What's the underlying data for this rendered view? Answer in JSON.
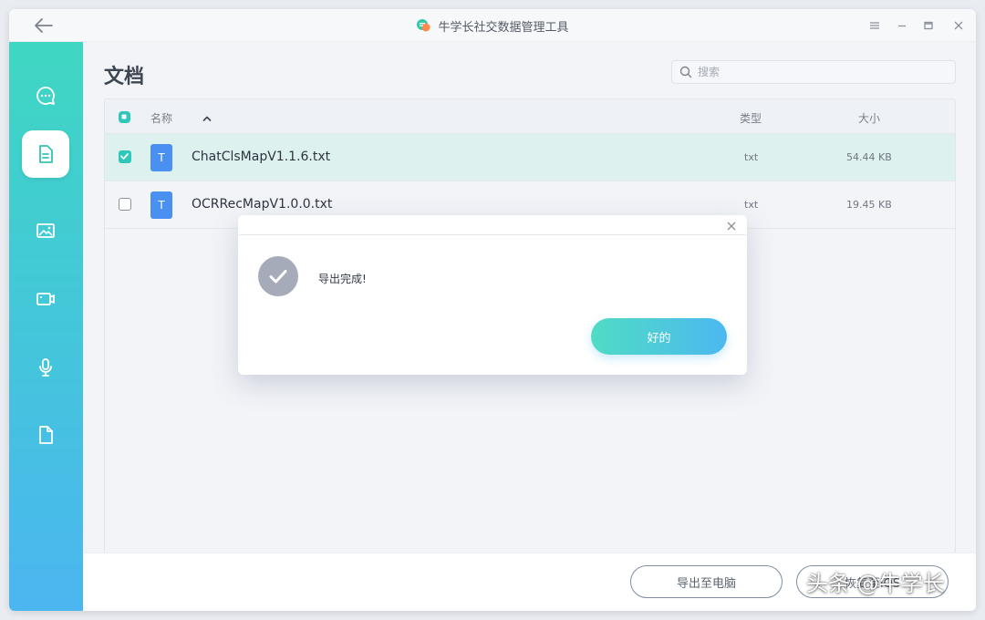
{
  "window": {
    "title": "牛学长社交数据管理工具"
  },
  "sidebar": {
    "items": [
      {
        "name": "messages",
        "icon": "chat-bubble-icon"
      },
      {
        "name": "documents",
        "icon": "document-icon",
        "active": true
      },
      {
        "name": "photos",
        "icon": "image-icon"
      },
      {
        "name": "videos",
        "icon": "video-icon"
      },
      {
        "name": "audio",
        "icon": "microphone-icon"
      },
      {
        "name": "files",
        "icon": "file-icon"
      }
    ]
  },
  "main": {
    "page_title": "文档",
    "search": {
      "placeholder": "搜索",
      "value": ""
    },
    "table": {
      "headers": {
        "name": "名称",
        "type": "类型",
        "size": "大小"
      },
      "rows": [
        {
          "icon_letter": "T",
          "name": "ChatClsMapV1.1.6.txt",
          "type": "txt",
          "size": "54.44 KB",
          "checked": true
        },
        {
          "icon_letter": "T",
          "name": "OCRRecMapV1.0.0.txt",
          "type": "txt",
          "size": "19.45 KB",
          "checked": false
        }
      ]
    }
  },
  "footer": {
    "export_pc_label": "导出至电脑",
    "restore_label": "恢复至iOS"
  },
  "modal": {
    "message": "导出完成!",
    "ok_label": "好的"
  },
  "watermark": "头条 @牛学长",
  "colors": {
    "accent": "#2fc7b7",
    "sidebar_top": "#3fd7c2",
    "sidebar_bottom": "#4bb6f0",
    "file_icon": "#4a90f0",
    "selected_row": "#ddf1ee"
  }
}
